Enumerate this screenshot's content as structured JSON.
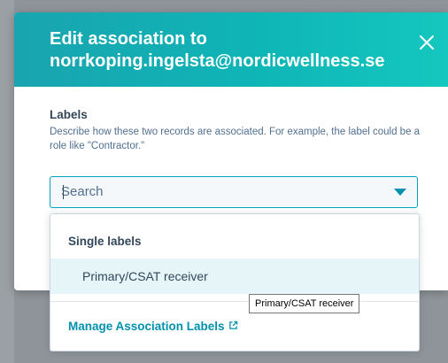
{
  "modal": {
    "title": "Edit association to norrkoping.ingelsta@nordicwellness.se",
    "close_icon": "close-icon",
    "accent": "#00a4bd",
    "header_gradient": [
      "#19a4b0",
      "#14c7bf"
    ]
  },
  "labels_section": {
    "heading": "Labels",
    "description": "Describe how these two records are associated. For example, the label could be a role like \"Contractor.\""
  },
  "search": {
    "placeholder": "Search",
    "value": "",
    "dropdown_icon": "caret-down-icon"
  },
  "dropdown": {
    "group_label": "Single labels",
    "options": [
      {
        "label": "Primary/CSAT receiver",
        "highlighted": true
      }
    ],
    "manage_link": "Manage Association Labels",
    "manage_link_icon": "external-link-icon"
  },
  "tooltip": {
    "text": "Primary/CSAT receiver"
  }
}
